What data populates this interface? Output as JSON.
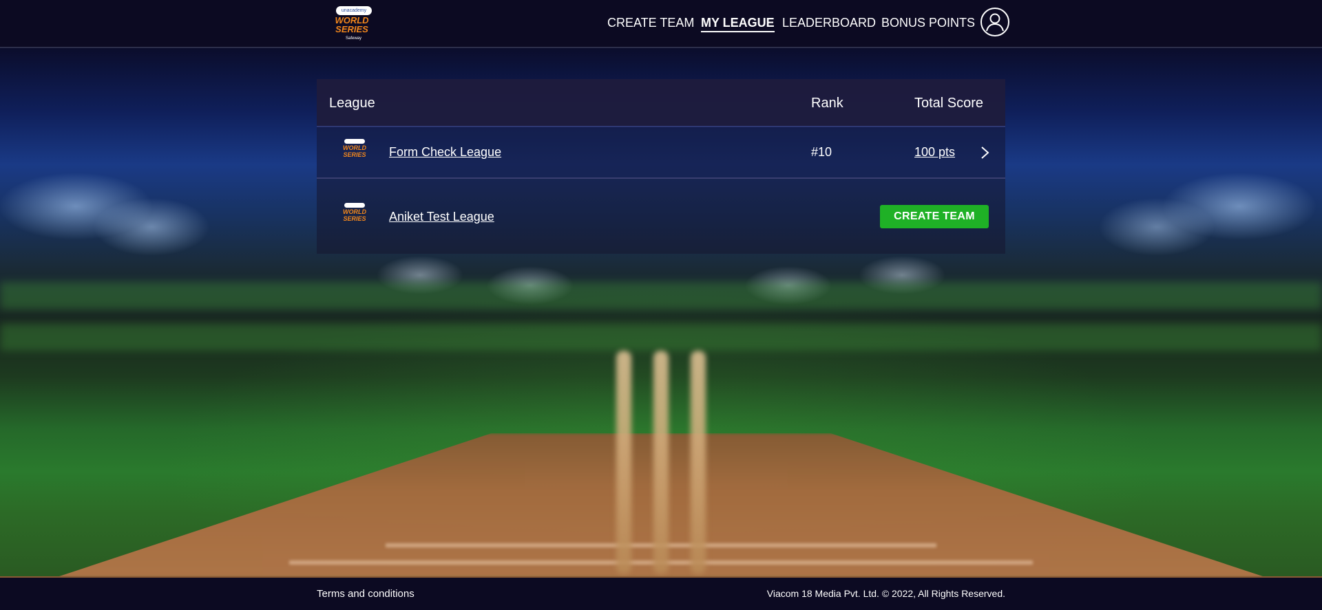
{
  "header": {
    "logo": {
      "badge_text": "unacademy",
      "title": "WORLD SERIES",
      "sub": "Safeway"
    },
    "nav": [
      {
        "label": "CREATE TEAM"
      },
      {
        "label": "MY LEAGUE",
        "active": true
      },
      {
        "label": "LEADERBOARD"
      },
      {
        "label": "BONUS POINTS"
      }
    ],
    "profile_icon": "user-icon"
  },
  "table": {
    "headers": {
      "league": "League",
      "rank": "Rank",
      "total_score": "Total Score"
    },
    "rows": [
      {
        "name": "Form Check League",
        "rank": "#10",
        "score": "100 pts",
        "action_icon": "chevron-right-icon"
      },
      {
        "name": "Aniket Test League",
        "action_label": "CREATE TEAM"
      }
    ]
  },
  "footer": {
    "terms": "Terms and conditions",
    "copyright": "Viacom 18 Media Pvt. Ltd. © 2022, All Rights Reserved."
  },
  "colors": {
    "header_bg": "#0c0a22",
    "create_button": "#1fb126",
    "logo_orange": "#f2871c"
  }
}
